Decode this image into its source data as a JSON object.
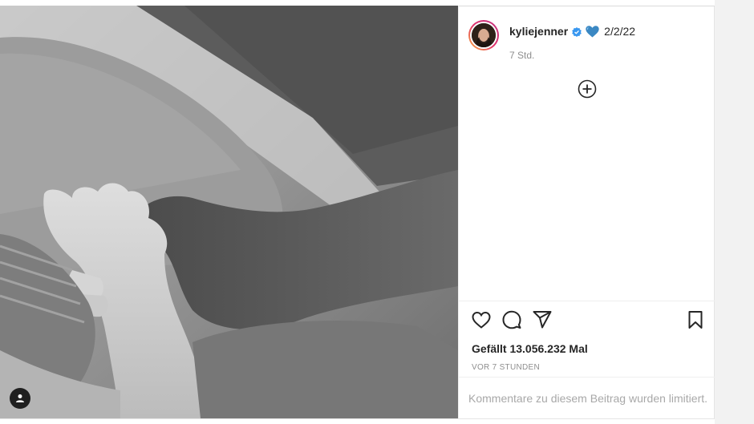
{
  "post": {
    "username": "kyliejenner",
    "caption_text": "2/2/22",
    "caption_emoji": "blue-heart",
    "time_ago": "7 Std.",
    "likes": "Gefällt 13.056.232 Mal",
    "post_time": "VOR 7 STUNDEN",
    "comments_limited": "Kommentare zu diesem Beitrag wurden limitiert."
  },
  "icons": {
    "verified": "verified-badge-icon",
    "heart_emoji": "blue-heart-icon",
    "load_more": "plus-circle-icon",
    "like": "heart-outline-icon",
    "comment": "comment-bubble-icon",
    "share": "paper-plane-icon",
    "save": "bookmark-icon",
    "user_tag": "user-tag-icon"
  },
  "colors": {
    "verified_blue": "#3897f0",
    "heart_blue": "#3b88c3",
    "text_primary": "#262626",
    "text_secondary": "#8e8e8e"
  }
}
